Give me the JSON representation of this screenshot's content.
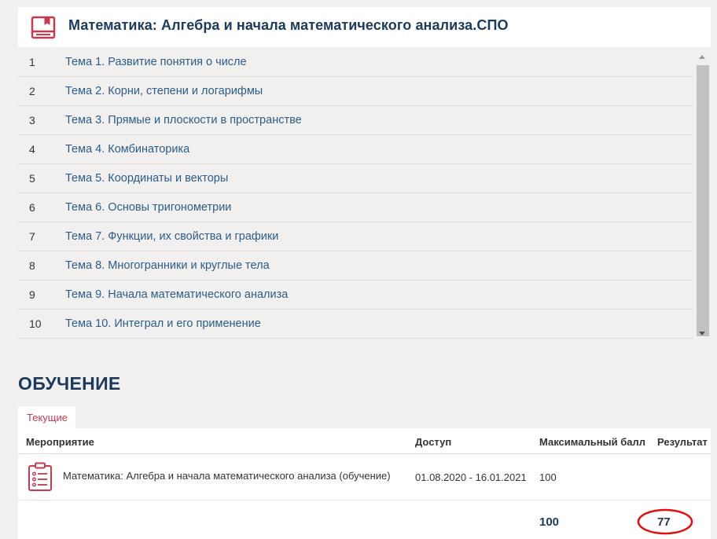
{
  "course": {
    "icon": "book-icon",
    "title": "Математика: Алгебра и начала математического анализа.СПО"
  },
  "topics": [
    {
      "num": "1",
      "label": "Тема 1. Развитие понятия о числе"
    },
    {
      "num": "2",
      "label": "Тема 2. Корни, степени и логарифмы"
    },
    {
      "num": "3",
      "label": "Тема 3. Прямые и плоскости в пространстве"
    },
    {
      "num": "4",
      "label": "Тема 4. Комбинаторика"
    },
    {
      "num": "5",
      "label": "Тема 5. Координаты и векторы"
    },
    {
      "num": "6",
      "label": "Тема 6. Основы тригонометрии"
    },
    {
      "num": "7",
      "label": "Тема 7. Функции, их свойства и графики"
    },
    {
      "num": "8",
      "label": "Тема 8. Многогранники и круглые тела"
    },
    {
      "num": "9",
      "label": "Тема 9. Начала математического анализа"
    },
    {
      "num": "10",
      "label": "Тема 10. Интеграл и его применение"
    }
  ],
  "training": {
    "title": "ОБУЧЕНИЕ",
    "tab_label": "Текущие",
    "headers": {
      "activity": "Мероприятие",
      "access": "Доступ",
      "max_score": "Максимальный балл",
      "result": "Результат"
    },
    "rows": [
      {
        "icon": "clipboard-list-icon",
        "activity": "Математика: Алгебра и начала математического анализа (обучение)",
        "access": "01.08.2020 - 16.01.2021",
        "max_score": "100"
      }
    ],
    "totals": {
      "max_score": "100",
      "result": "77"
    }
  },
  "colors": {
    "accent": "#c8384f",
    "heading": "#1b3a5c",
    "link": "#2a5d8a",
    "annotation": "#e01010"
  }
}
